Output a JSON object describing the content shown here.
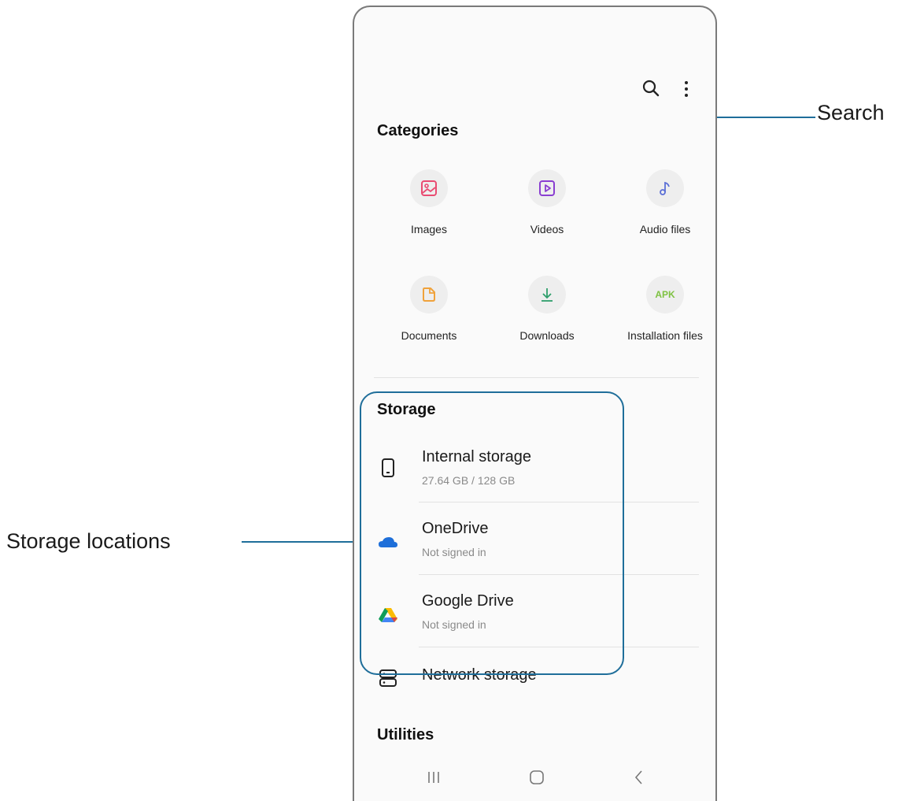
{
  "annotations": {
    "search_label": "Search",
    "storage_label": "Storage locations"
  },
  "colors": {
    "callout": "#1f6e9a",
    "images_icon": "#e94c72",
    "videos_icon": "#8a3fd1",
    "audio_icon": "#5b6fd6",
    "documents_icon": "#f0a23b",
    "downloads_icon": "#2e9e6b",
    "apk_icon": "#7ec242",
    "onedrive": "#1e6fd9"
  },
  "toolbar": {
    "search_icon": "search-icon",
    "more_icon": "more-options-icon"
  },
  "categories": {
    "title": "Categories",
    "items": [
      {
        "label": "Images",
        "icon": "image-icon"
      },
      {
        "label": "Videos",
        "icon": "video-icon"
      },
      {
        "label": "Audio files",
        "icon": "music-note-icon"
      },
      {
        "label": "Documents",
        "icon": "document-icon"
      },
      {
        "label": "Downloads",
        "icon": "download-icon"
      },
      {
        "label": "Installation files",
        "icon": "apk-icon",
        "icon_text": "APK"
      }
    ]
  },
  "storage": {
    "title": "Storage",
    "items": [
      {
        "name": "Internal storage",
        "sub": "27.64 GB / 128 GB",
        "icon": "phone-icon"
      },
      {
        "name": "OneDrive",
        "sub": "Not signed in",
        "icon": "onedrive-cloud-icon"
      },
      {
        "name": "Google Drive",
        "sub": "Not signed in",
        "icon": "google-drive-icon"
      },
      {
        "name": "Network storage",
        "sub": "",
        "icon": "network-storage-icon"
      }
    ]
  },
  "utilities": {
    "title": "Utilities"
  },
  "navbar": {
    "recents_icon": "recents-icon",
    "home_icon": "home-icon",
    "back_icon": "back-icon"
  }
}
